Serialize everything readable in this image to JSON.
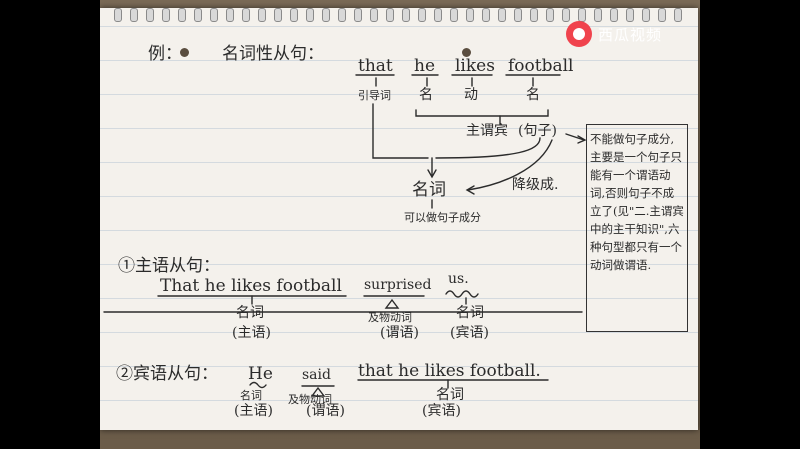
{
  "watermark": {
    "text": "西瓜视频",
    "logo_icon": "watermelon-logo-icon"
  },
  "notes": {
    "example_label": "例：",
    "topic": "名词性从句：",
    "sentence_words": [
      "that",
      "he",
      "likes",
      "football"
    ],
    "word_roles": [
      "引导词",
      "名",
      "动",
      "名"
    ],
    "svo": "主谓宾",
    "clause": "(句子)",
    "downgrade": "降级成.",
    "noun": "名词",
    "can_be_component": "可以做句子成分",
    "box_note": "不能做句子成分,主要是一个句子只能有一个谓语动词,否则句子不成立了(见\"二.主谓宾中的主干知识\",六种句型都只有一个动词做谓语.",
    "section1": {
      "label": "①主语从句：",
      "clause_text": "That he likes football",
      "clause_role_top": "名词",
      "clause_role_bottom": "(主语)",
      "verb": "surprised",
      "verb_role_top": "及物动词",
      "verb_role_bottom": "(谓语)",
      "object": "us.",
      "object_role_top": "名词",
      "object_role_bottom": "(宾语)"
    },
    "section2": {
      "label": "②宾语从句：",
      "subject": "He",
      "subject_role_top": "名词",
      "subject_role_bottom": "(主语)",
      "verb": "said",
      "verb_role_top": "及物动词",
      "verb_role_bottom": "(谓语)",
      "clause_text": "that he likes football.",
      "clause_role_top": "名词",
      "clause_role_bottom": "(宾语)"
    }
  }
}
